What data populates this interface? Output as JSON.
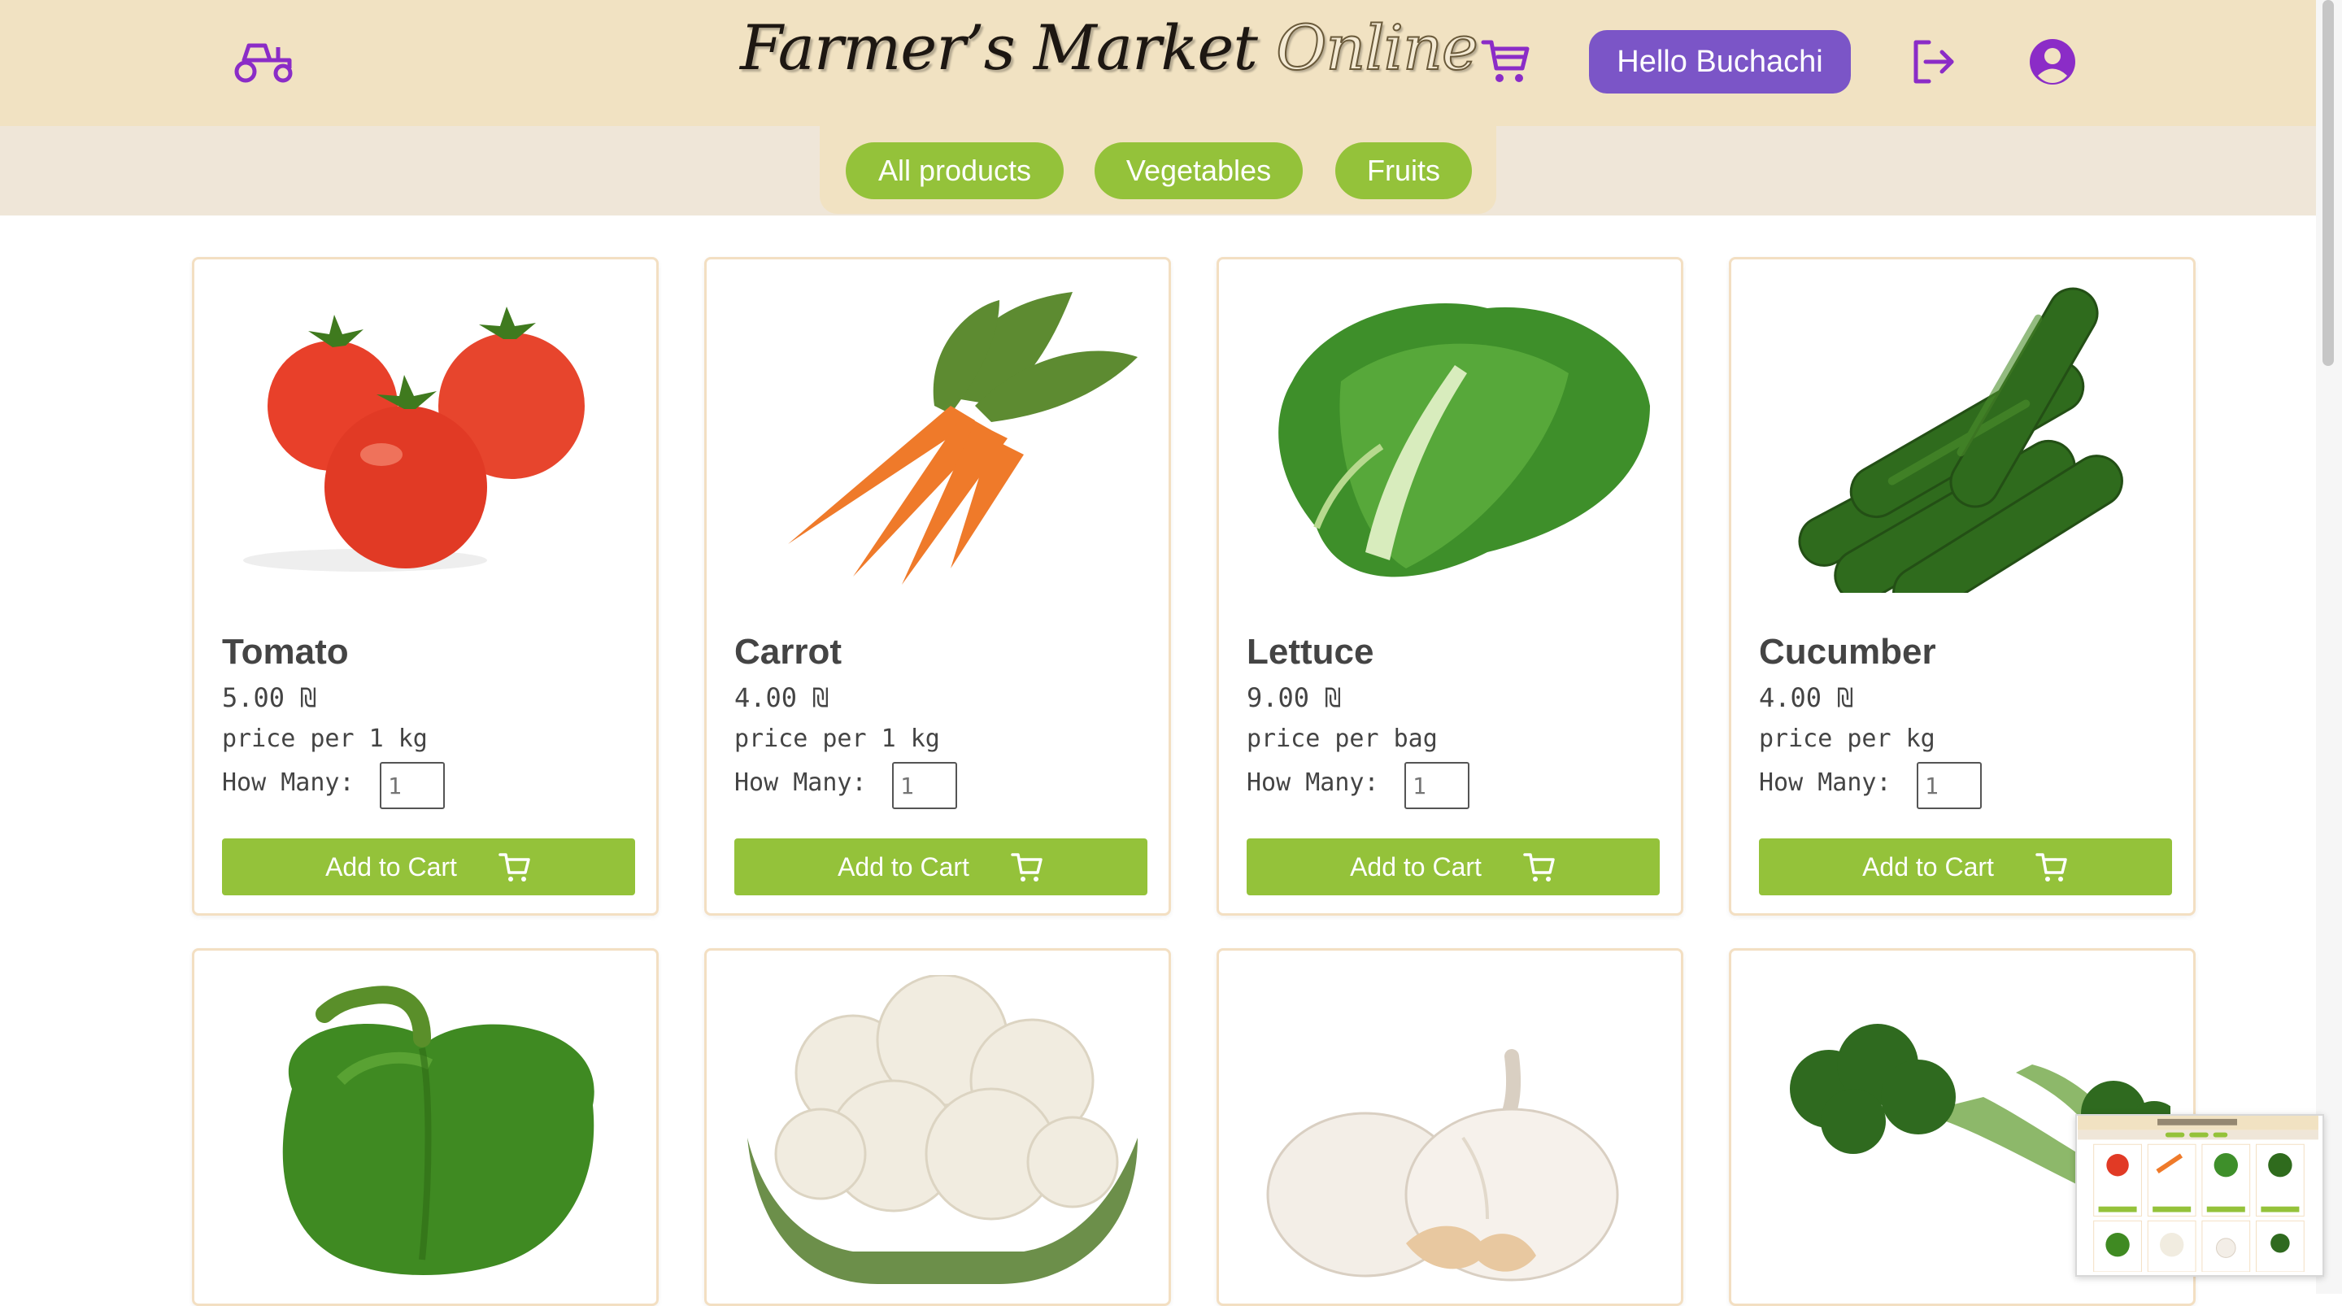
{
  "header": {
    "title_main": "Farmer’s Market",
    "title_accent": "Online",
    "greeting": "Hello Buchachi",
    "icons": [
      "tractor-icon",
      "cart-icon",
      "logout-icon",
      "account-icon"
    ]
  },
  "categories": [
    {
      "label": "All products"
    },
    {
      "label": "Vegetables"
    },
    {
      "label": "Fruits"
    }
  ],
  "products": [
    {
      "name": "Tomato",
      "price": "5.00 ₪",
      "unit": "price per 1 kg",
      "qty_label": "How Many:",
      "qty": "1",
      "button": "Add to Cart"
    },
    {
      "name": "Carrot",
      "price": "4.00 ₪",
      "unit": "price per 1 kg",
      "qty_label": "How Many:",
      "qty": "1",
      "button": "Add to Cart"
    },
    {
      "name": "Lettuce",
      "price": "9.00 ₪",
      "unit": "price per bag",
      "qty_label": "How Many:",
      "qty": "1",
      "button": "Add to Cart"
    },
    {
      "name": "Cucumber",
      "price": "4.00 ₪",
      "unit": "price per kg",
      "qty_label": "How Many:",
      "qty": "1",
      "button": "Add to Cart"
    }
  ],
  "colors": {
    "header_bg": "#f1e2c2",
    "accent_purple": "#7b55c7",
    "accent_green": "#94c23a",
    "card_border": "#f3dfc2"
  }
}
